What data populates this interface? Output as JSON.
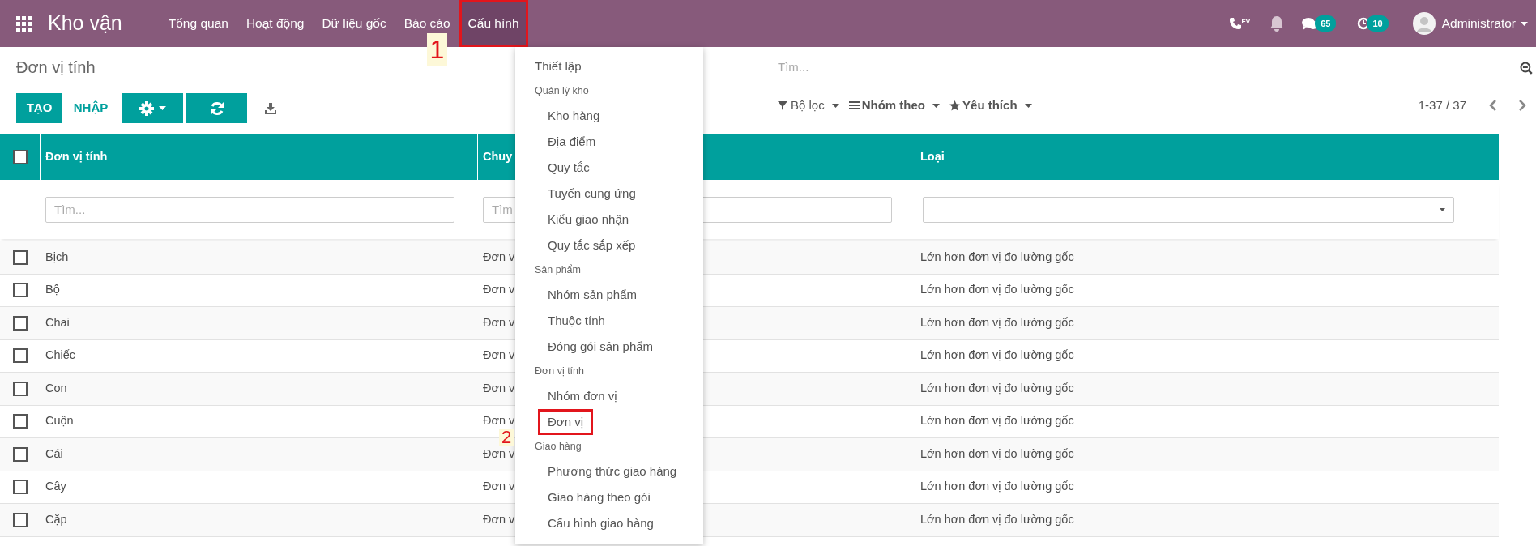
{
  "navbar": {
    "app_title": "Kho vận",
    "menu": [
      {
        "label": "Tổng quan",
        "selected": false
      },
      {
        "label": "Hoạt động",
        "selected": false
      },
      {
        "label": "Dữ liệu gốc",
        "selected": false
      },
      {
        "label": "Báo cáo",
        "selected": false
      },
      {
        "label": "Cấu hình",
        "selected": true,
        "callout": "1"
      }
    ],
    "phone_badge": "EV",
    "chat_count": "65",
    "activity_count": "10",
    "user": "Administrator"
  },
  "page": {
    "title": "Đơn vị tính",
    "create_button": "TẠO",
    "import_button": "NHẬP"
  },
  "search": {
    "placeholder": "Tìm..."
  },
  "filters": [
    "Bộ lọc",
    "Nhóm theo",
    "Yêu thích"
  ],
  "pager": "1-37 / 37",
  "table": {
    "select_all": {
      "checked": false
    },
    "columns": [
      "Đơn vị tính",
      "Chuy",
      "Loại"
    ],
    "filter_placeholders": [
      "Tìm...",
      "Tìm"
    ],
    "rows": [
      {
        "checked": false,
        "cells": [
          "Bịch",
          "Đơn v",
          "Lớn hơn đơn vị đo lường gốc"
        ]
      },
      {
        "checked": false,
        "cells": [
          "Bộ",
          "Đơn v",
          "Lớn hơn đơn vị đo lường gốc"
        ]
      },
      {
        "checked": false,
        "cells": [
          "Chai",
          "Đơn v",
          "Lớn hơn đơn vị đo lường gốc"
        ]
      },
      {
        "checked": false,
        "cells": [
          "Chiếc",
          "Đơn v",
          "Lớn hơn đơn vị đo lường gốc"
        ]
      },
      {
        "checked": false,
        "cells": [
          "Con",
          "Đơn v",
          "Lớn hơn đơn vị đo lường gốc"
        ]
      },
      {
        "checked": false,
        "cells": [
          "Cuộn",
          "Đơn v",
          "Lớn hơn đơn vị đo lường gốc"
        ]
      },
      {
        "checked": false,
        "cells": [
          "Cái",
          "Đơn v",
          "Lớn hơn đơn vị đo lường gốc"
        ]
      },
      {
        "checked": false,
        "cells": [
          "Cây",
          "Đơn v",
          "Lớn hơn đơn vị đo lường gốc"
        ]
      },
      {
        "checked": false,
        "cells": [
          "Cặp",
          "Đơn v",
          "Lớn hơn đơn vị đo lường gốc"
        ]
      }
    ]
  },
  "dropdown": {
    "items": [
      {
        "kind": "item",
        "label": "Thiết lập"
      },
      {
        "kind": "section",
        "label": "Quản lý kho",
        "children": [
          {
            "label": "Kho hàng"
          },
          {
            "label": "Địa điểm"
          },
          {
            "label": "Quy tắc"
          },
          {
            "label": "Tuyến cung ứng"
          },
          {
            "label": "Kiểu giao nhận"
          },
          {
            "label": "Quy tắc sắp xếp"
          }
        ]
      },
      {
        "kind": "section",
        "label": "Sản phẩm",
        "children": [
          {
            "label": "Nhóm sản phẩm"
          },
          {
            "label": "Thuộc tính"
          },
          {
            "label": "Đóng gói sản phẩm"
          }
        ]
      },
      {
        "kind": "section",
        "label": "Đơn vị tính",
        "children": [
          {
            "label": "Nhóm đơn vị"
          },
          {
            "label": "Đơn vị",
            "callout": "2"
          }
        ]
      },
      {
        "kind": "section",
        "label": "Giao hàng",
        "children": [
          {
            "label": "Phương thức giao hàng"
          },
          {
            "label": "Giao hàng theo gói"
          },
          {
            "label": "Cấu hình giao hàng"
          }
        ]
      }
    ]
  }
}
